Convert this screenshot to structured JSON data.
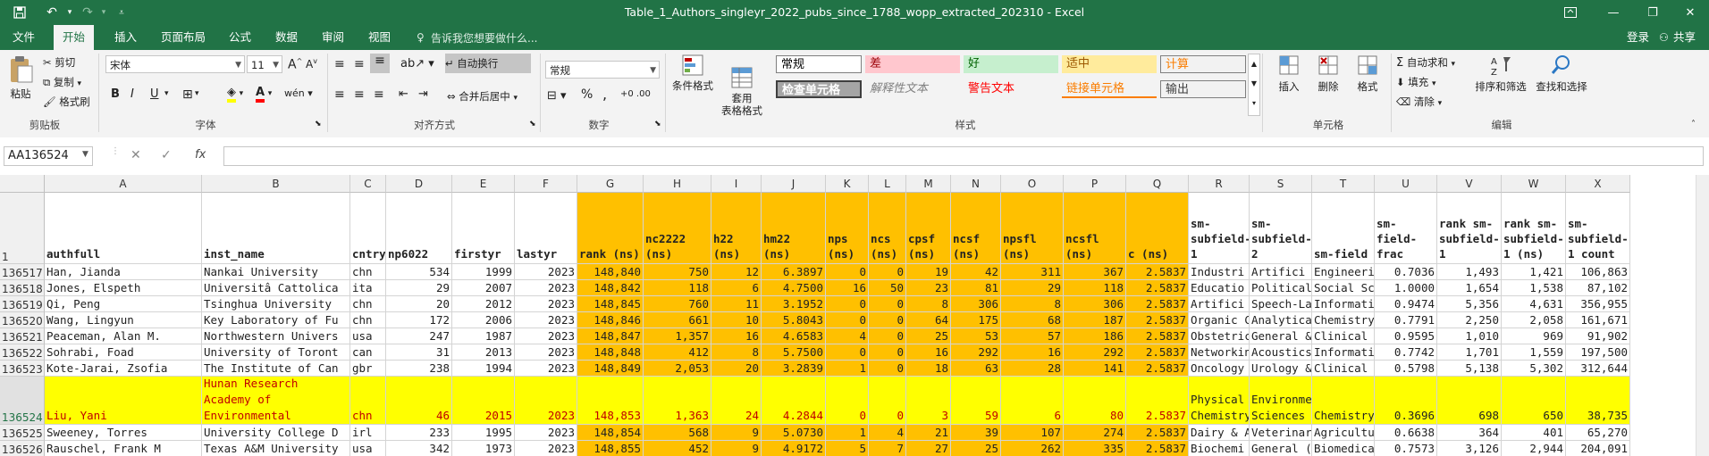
{
  "window": {
    "title": "Table_1_Authors_singleyr_2022_pubs_since_1788_wopp_extracted_202310 - Excel",
    "login": "登录",
    "share": "共享"
  },
  "tabs": [
    "文件",
    "开始",
    "插入",
    "页面布局",
    "公式",
    "数据",
    "审阅",
    "视图"
  ],
  "tell_me": "告诉我您想要做什么...",
  "ribbon": {
    "clipboard": {
      "paste": "粘贴",
      "cut": "剪切",
      "copy": "复制",
      "format_painter": "格式刷",
      "label": "剪贴板"
    },
    "font": {
      "name": "宋体",
      "size": "11",
      "bold": "B",
      "italic": "I",
      "underline": "U",
      "label": "字体"
    },
    "alignment": {
      "wrap": "自动换行",
      "merge": "合并后居中",
      "label": "对齐方式"
    },
    "number": {
      "format": "常规",
      "percent": "%",
      "comma": ",",
      "label": "数字"
    },
    "styles": {
      "cond_format": "条件格式",
      "table_format": "套用\n表格格式",
      "cells": [
        {
          "text": "常规",
          "bg": "#ffffff",
          "fg": "#000000"
        },
        {
          "text": "差",
          "bg": "#ffc7ce",
          "fg": "#9c0006"
        },
        {
          "text": "好",
          "bg": "#c6efce",
          "fg": "#006100"
        },
        {
          "text": "适中",
          "bg": "#ffeb9c",
          "fg": "#9c5700"
        },
        {
          "text": "计算",
          "bg": "#f2f2f2",
          "fg": "#fa7d00"
        },
        {
          "text": "检查单元格",
          "bg": "#a5a5a5",
          "fg": "#ffffff"
        },
        {
          "text": "解释性文本",
          "bg": "#f3f3f3",
          "fg": "#7f7f7f"
        },
        {
          "text": "警告文本",
          "bg": "#f3f3f3",
          "fg": "#ff0000"
        },
        {
          "text": "链接单元格",
          "bg": "#f3f3f3",
          "fg": "#fa7d00"
        },
        {
          "text": "输出",
          "bg": "#f2f2f2",
          "fg": "#3f3f3f"
        }
      ],
      "label": "样式"
    },
    "cells_group": {
      "insert": "插入",
      "delete": "删除",
      "format": "格式",
      "label": "单元格"
    },
    "editing": {
      "autosum": "自动求和",
      "fill": "填充",
      "clear": "清除",
      "sort": "排序和筛选",
      "find": "查找和选择",
      "label": "编辑"
    }
  },
  "formula_bar": {
    "name_box": "AA136524",
    "fx": "fx",
    "content": ""
  },
  "columns": [
    "A",
    "B",
    "C",
    "D",
    "E",
    "F",
    "G",
    "H",
    "I",
    "J",
    "K",
    "L",
    "M",
    "N",
    "O",
    "P",
    "Q",
    "R",
    "S",
    "T",
    "U",
    "V",
    "W",
    "X"
  ],
  "headers": [
    "authfull",
    "inst_name",
    "cntry",
    "np6022",
    "firstyr",
    "lastyr",
    "rank (ns)",
    "nc2222 (ns)",
    "h22 (ns)",
    "hm22 (ns)",
    "nps (ns)",
    "ncs (ns)",
    "cpsf (ns)",
    "ncsf (ns)",
    "npsfl (ns)",
    "ncsfl (ns)",
    "c (ns)",
    "sm-subfield-1",
    "sm-subfield-2",
    "sm-field",
    "sm-field-frac",
    "rank sm-subfield-1",
    "rank sm-subfield-1 (ns)",
    "sm-subfield-1 count"
  ],
  "header_row_number": "1",
  "rows": [
    {
      "n": "136517",
      "v": [
        "Han, Jianda",
        "Nankai University",
        "chn",
        "534",
        "1999",
        "2023",
        "148,840",
        "750",
        "12",
        "6.3897",
        "0",
        "0",
        "19",
        "42",
        "311",
        "367",
        "2.5837",
        "Industri",
        "Artifici",
        "Engineeri",
        "0.7036",
        "1,493",
        "1,421",
        "106,863"
      ]
    },
    {
      "n": "136518",
      "v": [
        "Jones, Elspeth",
        "Universitâ Cattolica",
        "ita",
        "29",
        "2007",
        "2023",
        "148,842",
        "118",
        "6",
        "4.7500",
        "16",
        "50",
        "23",
        "81",
        "29",
        "118",
        "2.5837",
        "Educatio",
        "Political",
        "Social Sc",
        "1.0000",
        "1,654",
        "1,538",
        "87,102"
      ]
    },
    {
      "n": "136519",
      "v": [
        "Qi, Peng",
        "Tsinghua University",
        "chn",
        "20",
        "2012",
        "2023",
        "148,845",
        "760",
        "11",
        "3.1952",
        "0",
        "0",
        "8",
        "306",
        "8",
        "306",
        "2.5837",
        "Artifici",
        "Speech-La",
        "Informati",
        "0.9474",
        "5,356",
        "4,631",
        "356,955"
      ]
    },
    {
      "n": "136520",
      "v": [
        "Wang, Lingyun",
        "Key Laboratory of Fu",
        "chn",
        "172",
        "2006",
        "2023",
        "148,846",
        "661",
        "10",
        "5.8043",
        "0",
        "0",
        "64",
        "175",
        "68",
        "187",
        "2.5837",
        "Organic C",
        "Analytica",
        "Chemistry",
        "0.7791",
        "2,250",
        "2,058",
        "161,671"
      ]
    },
    {
      "n": "136521",
      "v": [
        "Peaceman, Alan M.",
        "Northwestern Univers",
        "usa",
        "247",
        "1987",
        "2023",
        "148,847",
        "1,357",
        "16",
        "4.6583",
        "4",
        "0",
        "25",
        "53",
        "57",
        "186",
        "2.5837",
        "Obstetric",
        "General &",
        "Clinical",
        "0.9595",
        "1,010",
        "969",
        "91,902"
      ]
    },
    {
      "n": "136522",
      "v": [
        "Sohrabi, Foad",
        "University of Toront",
        "can",
        "31",
        "2013",
        "2023",
        "148,848",
        "412",
        "8",
        "5.7500",
        "0",
        "0",
        "16",
        "292",
        "16",
        "292",
        "2.5837",
        "Networkin",
        "Acoustics",
        "Informati",
        "0.7742",
        "1,701",
        "1,559",
        "197,500"
      ]
    },
    {
      "n": "136523",
      "v": [
        "Kote-Jarai, Zsofia",
        "The Institute of Can",
        "gbr",
        "238",
        "1994",
        "2023",
        "148,849",
        "2,053",
        "20",
        "3.2839",
        "1",
        "0",
        "18",
        "63",
        "28",
        "141",
        "2.5837",
        "Oncology",
        "Urology &",
        "Clinical",
        "0.5798",
        "5,138",
        "5,302",
        "312,644"
      ]
    },
    {
      "n": "136524",
      "hl": true,
      "v": [
        "Liu, Yani",
        "Hunan Research Academy of Environmental",
        "chn",
        "46",
        "2015",
        "2023",
        "148,853",
        "1,363",
        "24",
        "4.2844",
        "0",
        "0",
        "3",
        "59",
        "6",
        "80",
        "2.5837",
        "Physical Chemistry",
        "Environmental Sciences",
        "Chemistry",
        "0.3696",
        "698",
        "650",
        "38,735"
      ]
    },
    {
      "n": "136525",
      "v": [
        "Sweeney, Torres",
        "University College D",
        "irl",
        "233",
        "1995",
        "2023",
        "148,854",
        "568",
        "9",
        "5.0730",
        "1",
        "4",
        "21",
        "39",
        "107",
        "274",
        "2.5837",
        "Dairy & A",
        "Veterinar",
        "Agricultu",
        "0.6638",
        "364",
        "401",
        "65,270"
      ]
    },
    {
      "n": "136526",
      "v": [
        "Rauschel, Frank M",
        "Texas A&M University",
        "usa",
        "342",
        "1973",
        "2023",
        "148,855",
        "452",
        "9",
        "4.9172",
        "5",
        "7",
        "27",
        "25",
        "262",
        "335",
        "2.5837",
        "Biochemi",
        "General (",
        "Biomedica",
        "0.7573",
        "3,126",
        "2,944",
        "204,091"
      ]
    }
  ]
}
